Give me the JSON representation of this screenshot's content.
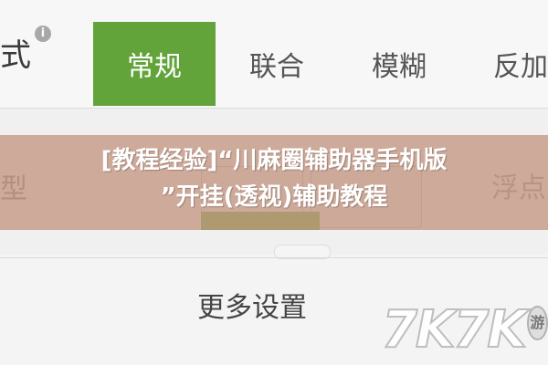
{
  "tabs_bar": {
    "left_label": "式",
    "info_icon": "i",
    "tabs": [
      {
        "label": "常规",
        "active": true
      },
      {
        "label": "联合",
        "active": false
      },
      {
        "label": "模糊",
        "active": false
      },
      {
        "label": "反加",
        "active": false
      }
    ]
  },
  "mode_row": {
    "left_label": "型",
    "right_label": "浮点"
  },
  "more_settings": "更多设置",
  "banner": {
    "line1": "[教程经验]“川麻圈辅助器手机版",
    "line2": "”开挂(透视)辅助教程"
  },
  "watermark": {
    "text": "7K7K",
    "badge": "游"
  },
  "colors": {
    "accent_green": "#62a33a",
    "banner_overlay": "#c49682"
  }
}
